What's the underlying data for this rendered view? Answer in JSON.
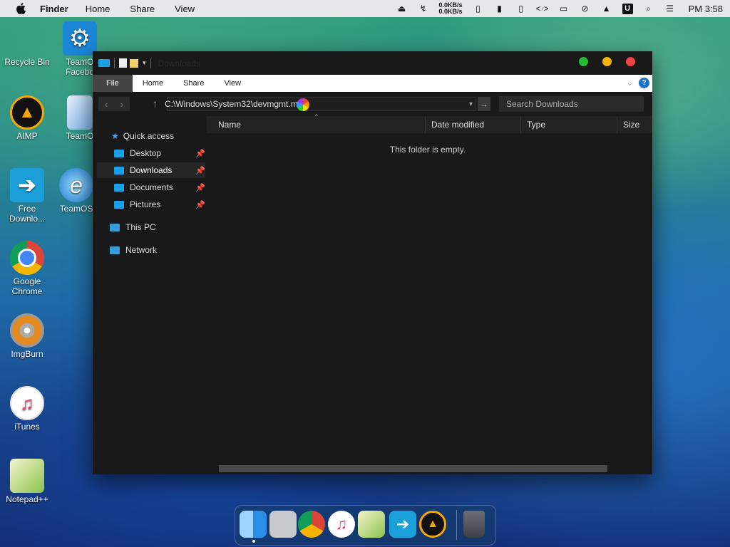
{
  "menubar": {
    "app_name": "Finder",
    "items": [
      "Home",
      "Share",
      "View"
    ],
    "net_up": "0.0KB/s",
    "net_down": "0.0KB/s",
    "clock": "PM 3:58"
  },
  "desktop": {
    "icons": [
      {
        "label": "Recycle Bin"
      },
      {
        "label": "TeamO Facebo"
      },
      {
        "label": "AIMP"
      },
      {
        "label": "TeamO"
      },
      {
        "label": "Free Downlo..."
      },
      {
        "label": "TeamOS"
      },
      {
        "label": "Google Chrome"
      },
      {
        "label": "ImgBurn"
      },
      {
        "label": "iTunes"
      },
      {
        "label": "Notepad++"
      }
    ]
  },
  "window": {
    "title": "Downloads",
    "ribbon_tabs": [
      "File",
      "Home",
      "Share",
      "View"
    ],
    "address": "C:\\Windows\\System32\\devmgmt.msc",
    "search_placeholder": "Search Downloads",
    "sidebar": {
      "quick_access": "Quick access",
      "items": [
        {
          "label": "Desktop"
        },
        {
          "label": "Downloads"
        },
        {
          "label": "Documents"
        },
        {
          "label": "Pictures"
        }
      ],
      "this_pc": "This PC",
      "network": "Network"
    },
    "columns": [
      "Name",
      "Date modified",
      "Type",
      "Size"
    ],
    "empty_message": "This folder is empty."
  },
  "colors": {
    "window_bg": "#191919",
    "accent_blue": "#1a73c8",
    "close": "#ee4444",
    "minimize": "#f5b400",
    "maximize": "#22bb33"
  }
}
